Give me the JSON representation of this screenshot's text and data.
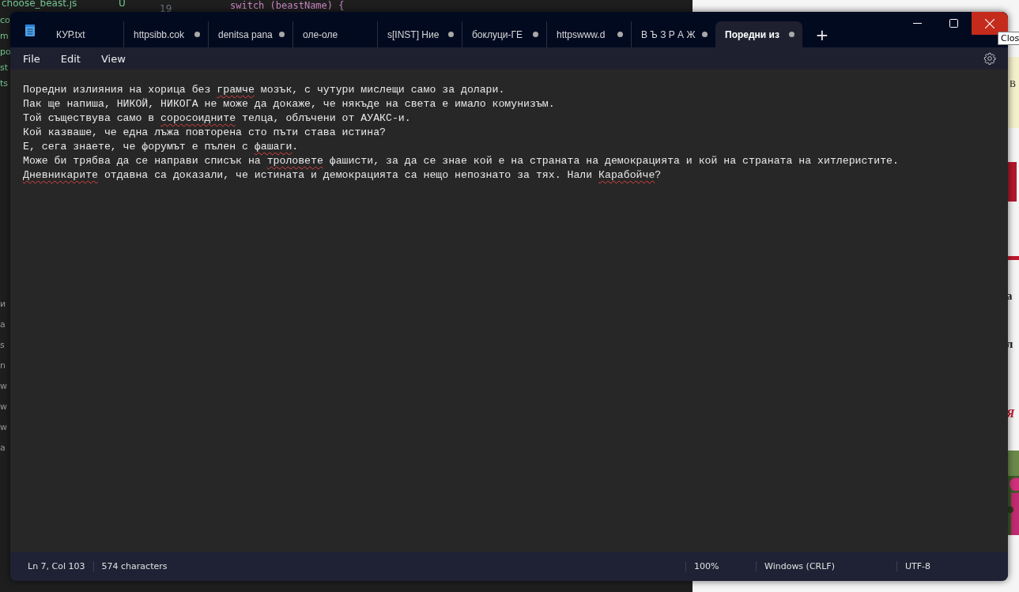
{
  "background": {
    "editor_file": "choose_beast.js",
    "editor_file_status": "U",
    "line_number": "19",
    "code": "switch (beastName) {",
    "left_fragments": [
      "co",
      "m",
      "po",
      "st",
      "ts"
    ],
    "lower_left_fragments": [
      "и",
      "a",
      "s",
      "n",
      "w",
      "w",
      "w",
      "a"
    ],
    "right_fragments": [
      "В",
      "а",
      "л",
      "Я"
    ],
    "tooltip": "Clos"
  },
  "window": {
    "tabs": [
      {
        "label": "КУР.txt",
        "modified": false,
        "selected": false
      },
      {
        "label": "httpsibb.cok",
        "modified": true,
        "selected": false
      },
      {
        "label": "denitsa pana",
        "modified": true,
        "selected": false
      },
      {
        "label": "оле-оле",
        "modified": false,
        "selected": false
      },
      {
        "label": "s[INST] Ние",
        "modified": true,
        "selected": false
      },
      {
        "label": "боклуци-ГЕ",
        "modified": true,
        "selected": false
      },
      {
        "label": "httpswww.d",
        "modified": true,
        "selected": false
      },
      {
        "label": "В Ъ З Р А Ж",
        "modified": true,
        "selected": false
      },
      {
        "label": "Поредни из",
        "modified": true,
        "selected": true
      }
    ],
    "new_tab": "+",
    "menu": [
      "File",
      "Edit",
      "View"
    ],
    "lines": [
      [
        {
          "text": "Поредни излияния на хорица без ",
          "misspelled": false
        },
        {
          "text": "грамче",
          "misspelled": true
        },
        {
          "text": " мозък, с чутури мислещи само за долари.",
          "misspelled": false
        }
      ],
      [
        {
          "text": "Пак ще напиша, НИКОЙ, НИКОГА не може да докаже, че някъде на света е имало комунизъм.",
          "misspelled": false
        }
      ],
      [
        {
          "text": "Той съществува само в ",
          "misspelled": false
        },
        {
          "text": "соросоидните",
          "misspelled": true
        },
        {
          "text": " телца, облъчени от АУАКС-и.",
          "misspelled": false
        }
      ],
      [
        {
          "text": "Кой казваше, че една лъжа повторена сто пъти става истина?",
          "misspelled": false
        }
      ],
      [
        {
          "text": "Е, сега знаете, че форумът е пълен с ",
          "misspelled": false
        },
        {
          "text": "фашаги",
          "misspelled": true
        },
        {
          "text": ".",
          "misspelled": false
        }
      ],
      [
        {
          "text": "Може би трябва да се направи списък на ",
          "misspelled": false
        },
        {
          "text": "троловете",
          "misspelled": true
        },
        {
          "text": " фашисти, за да се знае кой е на страната на демокрацията и кой на страната на хитлеристите.",
          "misspelled": false
        }
      ],
      [
        {
          "text": "Дневникарите",
          "misspelled": true
        },
        {
          "text": " отдавна са доказали, че истината и демокрацията са нещо непознато за тях. Нали ",
          "misspelled": false
        },
        {
          "text": "Карабойче",
          "misspelled": true
        },
        {
          "text": "?",
          "misspelled": false
        }
      ]
    ],
    "status_bar": {
      "position": "Ln 7, Col 103",
      "characters": "574 characters",
      "zoom": "100%",
      "line_endings": "Windows (CRLF)",
      "encoding": "UTF-8"
    }
  }
}
